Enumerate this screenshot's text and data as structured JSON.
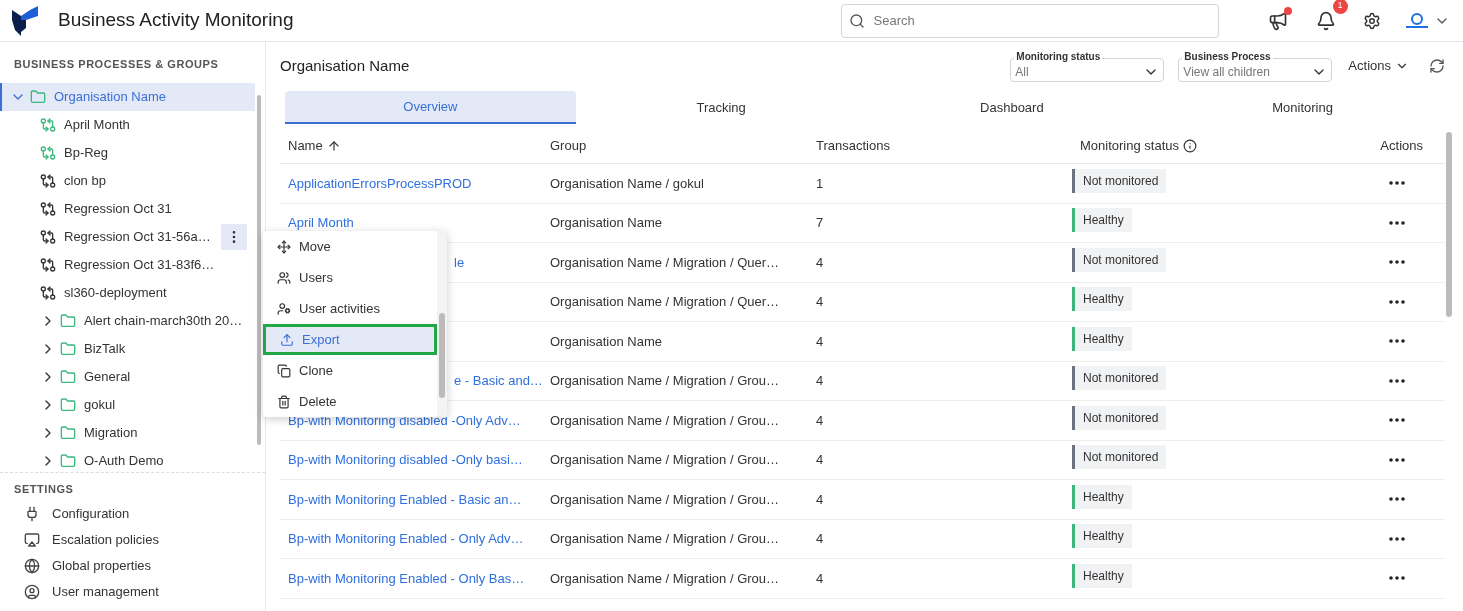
{
  "header": {
    "title": "Business Activity Monitoring",
    "search": {
      "placeholder": "Search"
    },
    "notifications": {
      "count": "1"
    }
  },
  "sidebar": {
    "heading": "BUSINESS PROCESSES & GROUPS",
    "tree": [
      {
        "kind": "group",
        "label": "Organisation Name",
        "expanded": true,
        "selected": true,
        "children": [
          {
            "kind": "process",
            "label": "April Month",
            "monitored": true,
            "menu_open": false
          },
          {
            "kind": "process",
            "label": "Bp-Reg",
            "monitored": true,
            "menu_open": false
          },
          {
            "kind": "process",
            "label": "clon bp",
            "monitored": false,
            "menu_open": false
          },
          {
            "kind": "process",
            "label": "Regression Oct 31",
            "monitored": false,
            "menu_open": false
          },
          {
            "kind": "process",
            "label": "Regression Oct 31-56a…",
            "monitored": false,
            "menu_open": true
          },
          {
            "kind": "process",
            "label": "Regression Oct 31-83f6…",
            "monitored": false,
            "menu_open": false
          },
          {
            "kind": "process",
            "label": "sl360-deployment",
            "monitored": false,
            "menu_open": false
          },
          {
            "kind": "group",
            "label": "Alert chain-march30th 20…",
            "expanded": false,
            "selected": false
          },
          {
            "kind": "group",
            "label": "BizTalk",
            "expanded": false,
            "selected": false
          },
          {
            "kind": "group",
            "label": "General",
            "expanded": false,
            "selected": false
          },
          {
            "kind": "group",
            "label": "gokul",
            "expanded": false,
            "selected": false
          },
          {
            "kind": "group",
            "label": "Migration",
            "expanded": false,
            "selected": false
          },
          {
            "kind": "group",
            "label": "O-Auth Demo",
            "expanded": false,
            "selected": false
          }
        ]
      }
    ],
    "settings_heading": "SETTINGS",
    "settings": [
      {
        "kind": "plug",
        "label": "Configuration"
      },
      {
        "kind": "screen",
        "label": "Escalation policies"
      },
      {
        "kind": "globe",
        "label": "Global properties"
      },
      {
        "kind": "user",
        "label": "User management"
      }
    ]
  },
  "context_menu": [
    {
      "kind": "move",
      "label": "Move",
      "selected": false
    },
    {
      "kind": "users",
      "label": "Users",
      "selected": false
    },
    {
      "kind": "activity",
      "label": "User activities",
      "selected": false
    },
    {
      "kind": "export",
      "label": "Export",
      "selected": true
    },
    {
      "kind": "clone",
      "label": "Clone",
      "selected": false
    },
    {
      "kind": "delete",
      "label": "Delete",
      "selected": false
    }
  ],
  "page_title": "Organisation Name",
  "filters": [
    {
      "label": "Monitoring status",
      "value": "All"
    },
    {
      "label": "Business Process",
      "value": "View all children"
    }
  ],
  "actions_label": "Actions",
  "tabs": [
    {
      "label": "Overview",
      "selected": true
    },
    {
      "label": "Tracking",
      "selected": false
    },
    {
      "label": "Dashboard",
      "selected": false
    },
    {
      "label": "Monitoring",
      "selected": false
    }
  ],
  "table": {
    "columns": [
      "Name",
      "Group",
      "Transactions",
      "Monitoring status",
      "Actions"
    ],
    "rows": [
      {
        "name": "ApplicationErrorsProcessPROD",
        "group": "Organisation Name / gokul",
        "transactions": "1",
        "status": {
          "kind": "not_monitored",
          "label": "Not monitored"
        }
      },
      {
        "name": "April Month",
        "group": "Organisation Name",
        "transactions": "7",
        "status": {
          "kind": "healthy",
          "label": "Healthy"
        }
      },
      {
        "name": "le",
        "name_partial": true,
        "group": "Organisation Name / Migration / Quer…",
        "transactions": "4",
        "status": {
          "kind": "not_monitored",
          "label": "Not monitored"
        }
      },
      {
        "group": "Organisation Name / Migration / Quer…",
        "transactions": "4",
        "status": {
          "kind": "healthy",
          "label": "Healthy"
        }
      },
      {
        "group": "Organisation Name",
        "transactions": "4",
        "status": {
          "kind": "healthy",
          "label": "Healthy"
        }
      },
      {
        "name": "e - Basic and…",
        "name_partial": true,
        "group": "Organisation Name / Migration / Grou…",
        "transactions": "4",
        "status": {
          "kind": "not_monitored",
          "label": "Not monitored"
        }
      },
      {
        "name": "Bp-with Monitoring disabled -Only Adv…",
        "group": "Organisation Name / Migration / Grou…",
        "transactions": "4",
        "status": {
          "kind": "not_monitored",
          "label": "Not monitored"
        }
      },
      {
        "name": "Bp-with Monitoring disabled -Only basi…",
        "group": "Organisation Name / Migration / Grou…",
        "transactions": "4",
        "status": {
          "kind": "not_monitored",
          "label": "Not monitored"
        }
      },
      {
        "name": "Bp-with Monitoring Enabled - Basic an…",
        "group": "Organisation Name / Migration / Grou…",
        "transactions": "4",
        "status": {
          "kind": "healthy",
          "label": "Healthy"
        }
      },
      {
        "name": "Bp-with Monitoring Enabled - Only Adv…",
        "group": "Organisation Name / Migration / Grou…",
        "transactions": "4",
        "status": {
          "kind": "healthy",
          "label": "Healthy"
        }
      },
      {
        "name": "Bp-with Monitoring Enabled - Only Bas…",
        "group": "Organisation Name / Migration / Grou…",
        "transactions": "4",
        "status": {
          "kind": "healthy",
          "label": "Healthy"
        }
      }
    ]
  }
}
